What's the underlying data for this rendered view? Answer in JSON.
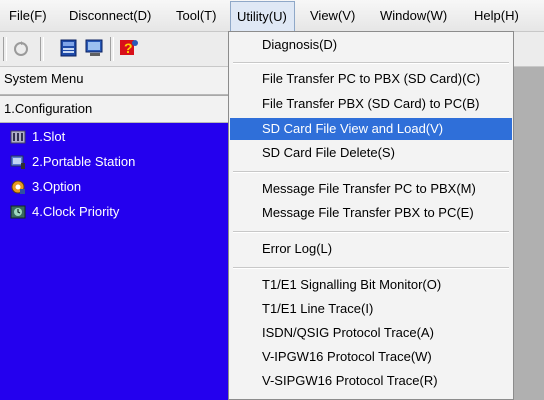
{
  "menubar": {
    "items": [
      {
        "label": "File(F)"
      },
      {
        "label": "Disconnect(D)"
      },
      {
        "label": "Tool(T)"
      },
      {
        "label": "Utility(U)"
      },
      {
        "label": "View(V)"
      },
      {
        "label": "Window(W)"
      },
      {
        "label": "Help(H)"
      }
    ],
    "active": "Utility(U)"
  },
  "toolbar": {
    "buttons": [
      "connect-icon",
      "card-icon",
      "monitor-icon",
      "help-icon"
    ]
  },
  "left_panel": {
    "system_menu_label": "System Menu",
    "section_label": "1.Configuration",
    "tree_items": [
      {
        "label": "1.Slot",
        "icon": "slot-icon"
      },
      {
        "label": "2.Portable Station",
        "icon": "portable-station-icon"
      },
      {
        "label": "3.Option",
        "icon": "option-icon"
      },
      {
        "label": "4.Clock Priority",
        "icon": "clock-priority-icon"
      }
    ],
    "background_color": "#2400ee"
  },
  "utility_menu": {
    "items": [
      {
        "label": "Diagnosis(D)"
      },
      {
        "label": "File Transfer PC to PBX (SD Card)(C)"
      },
      {
        "label": "File Transfer PBX (SD Card) to PC(B)"
      },
      {
        "label": "SD Card File View and Load(V)"
      },
      {
        "label": "SD Card File Delete(S)"
      },
      {
        "label": "Message File Transfer PC to PBX(M)"
      },
      {
        "label": "Message File Transfer PBX to PC(E)"
      },
      {
        "label": "Error Log(L)"
      },
      {
        "label": "T1/E1 Signalling Bit Monitor(O)"
      },
      {
        "label": "T1/E1 Line Trace(I)"
      },
      {
        "label": "ISDN/QSIG Protocol Trace(A)"
      },
      {
        "label": "V-IPGW16 Protocol Trace(W)"
      },
      {
        "label": "V-SIPGW16 Protocol Trace(R)"
      }
    ],
    "highlighted": "SD Card File View and Load(V)",
    "highlight_color": "#2f6fd9"
  }
}
